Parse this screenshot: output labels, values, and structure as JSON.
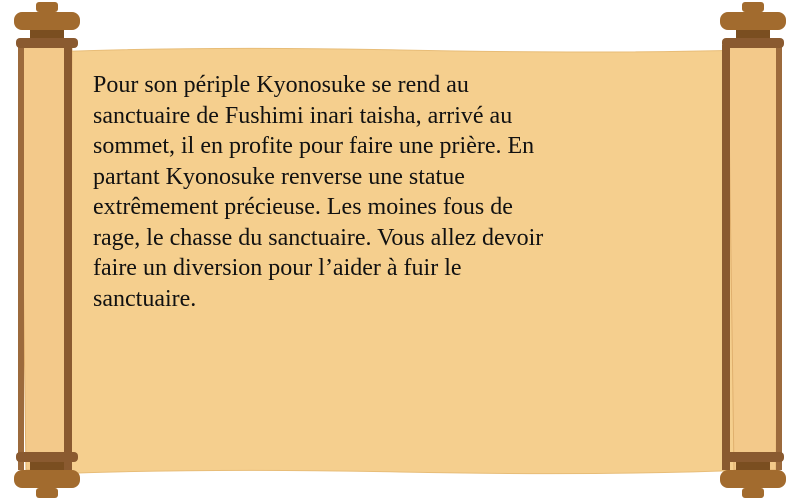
{
  "scroll": {
    "lines": [
      "Pour son périple Kyonosuke se rend au",
      "sanctuaire de Fushimi inari taisha, arrivé au",
      "sommet, il en profite pour faire une prière. En",
      "partant Kyonosuke renverse une statue",
      "extrêmement précieuse. Les moines fous de",
      "rage, le chasse du sanctuaire. Vous allez devoir",
      "faire un diversion pour l’aider à fuir le",
      "sanctuaire."
    ]
  },
  "colors": {
    "parchment": "#f5cf8e",
    "rod": "#9c6a3c",
    "rod_dark": "#6e4a28",
    "knob": "#a26b2e",
    "knob_dark": "#7a4e20",
    "text": "#111111"
  }
}
